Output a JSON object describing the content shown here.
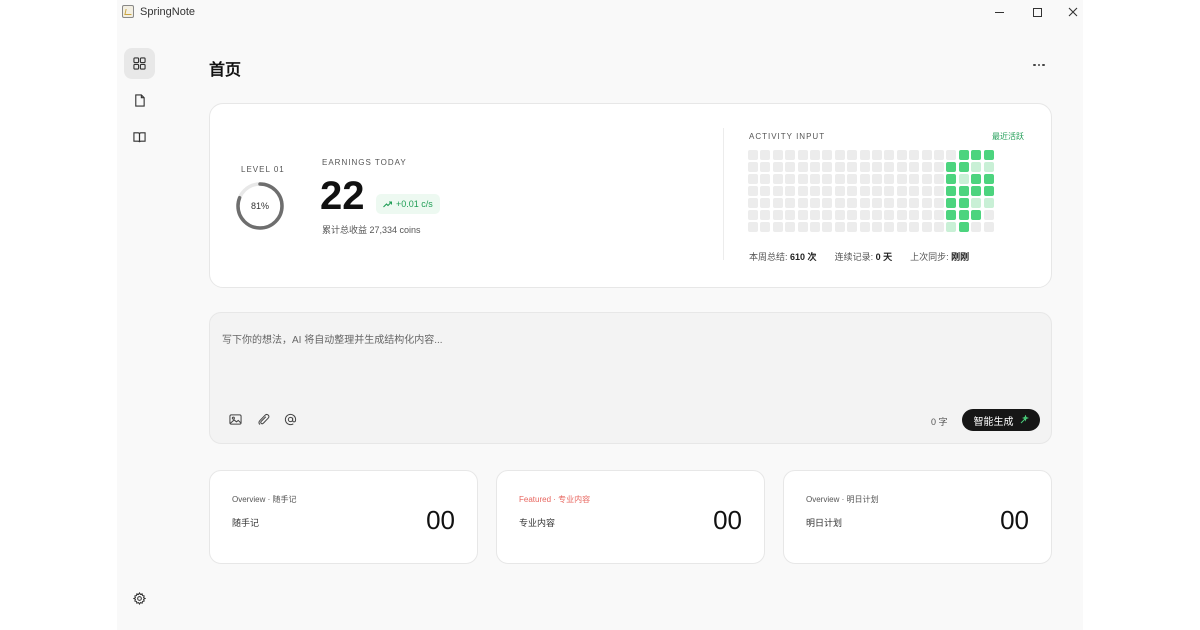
{
  "app": {
    "title": "SpringNote"
  },
  "header": {
    "title": "首页"
  },
  "stats": {
    "level_label": "LEVEL 01",
    "level_progress": 81,
    "level_progress_text": "81%",
    "earnings_label": "EARNINGS TODAY",
    "earnings_value": "22",
    "rate": "+0.01 c/s",
    "total_text": "累计总收益 27,334 coins"
  },
  "activity": {
    "label": "ACTIVITY INPUT",
    "link": "最近活跃",
    "weeks": 20,
    "days": 7,
    "levels": [
      [
        0,
        0,
        0,
        0,
        0,
        0,
        0
      ],
      [
        0,
        0,
        0,
        0,
        0,
        0,
        0
      ],
      [
        0,
        0,
        0,
        0,
        0,
        0,
        0
      ],
      [
        0,
        0,
        0,
        0,
        0,
        0,
        0
      ],
      [
        0,
        0,
        0,
        0,
        0,
        0,
        0
      ],
      [
        0,
        0,
        0,
        0,
        0,
        0,
        0
      ],
      [
        0,
        0,
        0,
        0,
        0,
        0,
        0
      ],
      [
        0,
        0,
        0,
        0,
        0,
        0,
        0
      ],
      [
        0,
        0,
        0,
        0,
        0,
        0,
        0
      ],
      [
        0,
        0,
        0,
        0,
        0,
        0,
        0
      ],
      [
        0,
        0,
        0,
        0,
        0,
        0,
        0
      ],
      [
        0,
        0,
        0,
        0,
        0,
        0,
        0
      ],
      [
        0,
        0,
        0,
        0,
        0,
        0,
        0
      ],
      [
        0,
        0,
        0,
        0,
        0,
        0,
        0
      ],
      [
        0,
        0,
        0,
        0,
        0,
        0,
        0
      ],
      [
        0,
        0,
        0,
        0,
        0,
        0,
        0
      ],
      [
        0,
        3,
        3,
        3,
        3,
        3,
        1
      ],
      [
        3,
        3,
        1,
        3,
        3,
        3,
        3
      ],
      [
        3,
        1,
        3,
        3,
        1,
        3,
        0
      ],
      [
        3,
        1,
        3,
        3,
        1,
        0,
        0
      ]
    ],
    "colors": {
      "empty": "#ececec",
      "low": "#c9f0d6",
      "high": "#4cd47e"
    },
    "footer": [
      {
        "label": "本周总结:",
        "value": "610 次"
      },
      {
        "label": "连续记录:",
        "value": "0 天"
      },
      {
        "label": "上次同步:",
        "value": "刚刚"
      }
    ]
  },
  "editor": {
    "placeholder": "写下你的想法，AI 将自动整理并生成结构化内容...",
    "char_count": "0 字",
    "generate_label": "智能生成"
  },
  "cards": [
    {
      "tag": "Overview · 随手记",
      "subtitle": "随手记",
      "value": "00",
      "featured": false
    },
    {
      "tag": "Featured · 专业内容",
      "subtitle": "专业内容",
      "value": "00",
      "featured": true
    },
    {
      "tag": "Overview · 明日计划",
      "subtitle": "明日计划",
      "value": "00",
      "featured": false
    }
  ]
}
